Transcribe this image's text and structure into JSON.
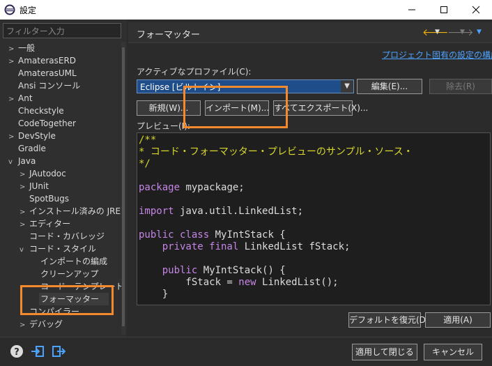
{
  "window": {
    "title": "設定"
  },
  "filter": {
    "placeholder": "フィルター入力"
  },
  "tree": [
    {
      "label": "一般",
      "arrow": ">"
    },
    {
      "label": "AmaterasERD",
      "arrow": ">"
    },
    {
      "label": "AmaterasUML",
      "arrow": ""
    },
    {
      "label": "Ansi コンソール",
      "arrow": ""
    },
    {
      "label": "Ant",
      "arrow": ">"
    },
    {
      "label": "Checkstyle",
      "arrow": ""
    },
    {
      "label": "CodeTogether",
      "arrow": ""
    },
    {
      "label": "DevStyle",
      "arrow": ">"
    },
    {
      "label": "Gradle",
      "arrow": ""
    },
    {
      "label": "Java",
      "arrow": "v"
    },
    {
      "label": "JAutodoc",
      "arrow": ">"
    },
    {
      "label": "JUnit",
      "arrow": ">"
    },
    {
      "label": "SpotBugs",
      "arrow": ""
    },
    {
      "label": "インストール済みの JRE",
      "arrow": ">"
    },
    {
      "label": "エディター",
      "arrow": ">"
    },
    {
      "label": "コード・カバレッジ",
      "arrow": ""
    },
    {
      "label": "コード・スタイル",
      "arrow": "v"
    },
    {
      "label": "インポートの編成",
      "arrow": ""
    },
    {
      "label": "クリーンアップ",
      "arrow": ""
    },
    {
      "label": "コード・テンプレート",
      "arrow": ""
    },
    {
      "label": "フォーマッター",
      "arrow": ""
    },
    {
      "label": "コンパイラー",
      "arrow": ""
    },
    {
      "label": "デバッグ",
      "arrow": ">"
    }
  ],
  "page": {
    "title": "フォーマッター",
    "project_link": "プロジェクト固有の設定の構成...",
    "profile_label": "アクティブなプロファイル(C):",
    "profile_value": "Eclipse [ビルトイン]",
    "edit_button": "編集(E)...",
    "remove_button": "除去(R)",
    "new_button": "新規(W)...",
    "import_button": "インポート(M)...",
    "export_all_button": "すべてエクスポート(X)...",
    "preview_label": "プレビュー(I):",
    "restore_button": "デフォルトを復元(D)",
    "apply_button": "適用(A)"
  },
  "code": {
    "l1": "/**",
    "l2": "* コード・フォーマッター・プレビューのサンプル・ソース・",
    "l3": "*/",
    "l5_kw": "package",
    "l5_rest": " mypackage;",
    "l7_kw": "import",
    "l7_rest": " java.util.LinkedList;",
    "l9_kw": "public class",
    "l9_rest": " MyIntStack {",
    "l10_kw": "    private final",
    "l10_rest": " LinkedList fStack;",
    "l12_kw": "    public",
    "l12_rest": " MyIntStack() {",
    "l13_a": "        fStack = ",
    "l13_kw": "new",
    "l13_b": " LinkedList();",
    "l14": "    }"
  },
  "bottom": {
    "apply_close_button": "適用して閉じる",
    "cancel_button": "キャンセル"
  },
  "colors": {
    "accent": "#f58a2d",
    "link": "#4ca3ff",
    "selection": "#1f4d8a"
  }
}
